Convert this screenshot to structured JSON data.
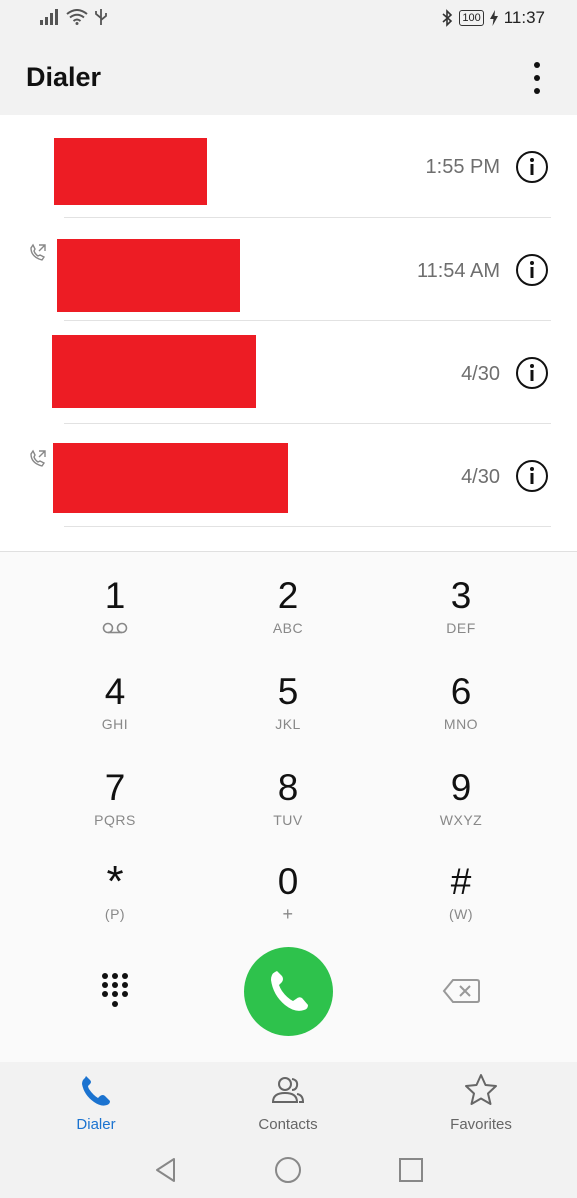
{
  "status_bar": {
    "time": "11:37",
    "battery": "100"
  },
  "app_bar": {
    "title": "Dialer"
  },
  "call_log": [
    {
      "time": "1:55 PM",
      "outgoing": false
    },
    {
      "time": "11:54 AM",
      "outgoing": true
    },
    {
      "time": "4/30",
      "outgoing": false
    },
    {
      "time": "4/30",
      "outgoing": true
    }
  ],
  "dialpad": {
    "keys": [
      {
        "digit": "1",
        "letters": ""
      },
      {
        "digit": "2",
        "letters": "ABC"
      },
      {
        "digit": "3",
        "letters": "DEF"
      },
      {
        "digit": "4",
        "letters": "GHI"
      },
      {
        "digit": "5",
        "letters": "JKL"
      },
      {
        "digit": "6",
        "letters": "MNO"
      },
      {
        "digit": "7",
        "letters": "PQRS"
      },
      {
        "digit": "8",
        "letters": "TUV"
      },
      {
        "digit": "9",
        "letters": "WXYZ"
      },
      {
        "digit": "*",
        "letters": "(P)"
      },
      {
        "digit": "0",
        "letters": "+"
      },
      {
        "digit": "#",
        "letters": "(W)"
      }
    ]
  },
  "tabs": [
    {
      "label": "Dialer",
      "icon": "phone-icon",
      "active": true
    },
    {
      "label": "Contacts",
      "icon": "contacts-icon",
      "active": false
    },
    {
      "label": "Favorites",
      "icon": "star-icon",
      "active": false
    }
  ],
  "colors": {
    "accent": "#1b73d0",
    "call_green": "#2ec24c",
    "redaction": "#ed1c24"
  }
}
